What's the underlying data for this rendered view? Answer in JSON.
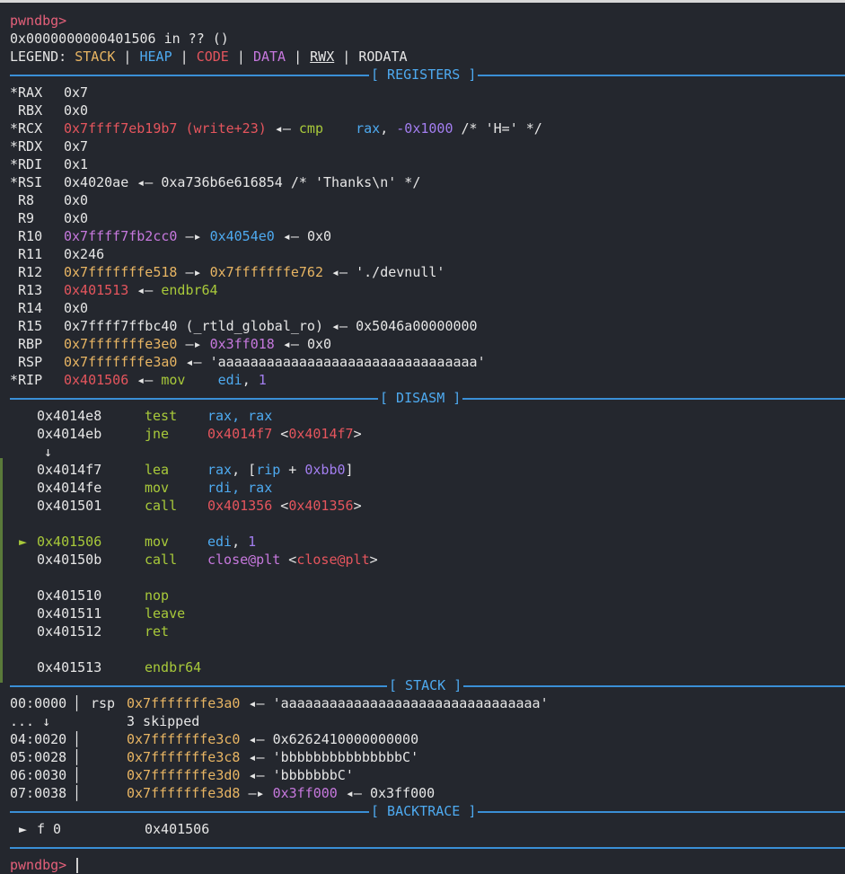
{
  "prompt": "pwndbg>",
  "location": "0x0000000000401506 in ?? ()",
  "legend": {
    "label": "LEGEND:",
    "stack": "STACK",
    "heap": "HEAP",
    "code": "CODE",
    "data": "DATA",
    "rwx": "RWX",
    "rodata": "RODATA",
    "sep": " | "
  },
  "sections": {
    "registers": "[ REGISTERS ]",
    "disasm": "[ DISASM ]",
    "stack": "[ STACK ]",
    "backtrace": "[ BACKTRACE ]"
  },
  "arrows": {
    "left": " ◂— ",
    "right": " —▸ "
  },
  "registers": {
    "rax": {
      "name": "*RAX",
      "val": "0x7"
    },
    "rbx": {
      "name": " RBX",
      "val": "0x0"
    },
    "rcx": {
      "name": "*RCX",
      "val": "0x7ffff7eb19b7 (write+23)",
      "mn": "cmp",
      "op1": "rax",
      "op2": "-0x1000",
      "cmt": " /* 'H=' */"
    },
    "rdx": {
      "name": "*RDX",
      "val": "0x7"
    },
    "rdi": {
      "name": "*RDI",
      "val": "0x1"
    },
    "rsi": {
      "name": "*RSI",
      "val": "0x4020ae",
      "deref": "0xa736b6e616854",
      "cmt": " /* 'Thanks\\n' */"
    },
    "r8": {
      "name": " R8",
      "val": "0x0"
    },
    "r9": {
      "name": " R9",
      "val": "0x0"
    },
    "r10": {
      "name": " R10",
      "val": "0x7ffff7fb2cc0",
      "p1": "0x4054e0",
      "p2": "0x0"
    },
    "r11": {
      "name": " R11",
      "val": "0x246"
    },
    "r12": {
      "name": " R12",
      "val": "0x7fffffffe518",
      "p1": "0x7fffffffe762",
      "str": "'./devnull'"
    },
    "r13": {
      "name": " R13",
      "val": "0x401513",
      "mn": "endbr64"
    },
    "r14": {
      "name": " R14",
      "val": "0x0"
    },
    "r15": {
      "name": " R15",
      "val": "0x7ffff7ffbc40 (_rtld_global_ro)",
      "deref": "0x5046a00000000"
    },
    "rbp": {
      "name": " RBP",
      "val": "0x7fffffffe3e0",
      "p1": "0x3ff018",
      "p2": "0x0"
    },
    "rsp": {
      "name": " RSP",
      "val": "0x7fffffffe3a0",
      "str": "'aaaaaaaaaaaaaaaaaaaaaaaaaaaaaaaa'"
    },
    "rip": {
      "name": "*RIP",
      "val": "0x401506",
      "mn": "mov",
      "op1": "edi",
      "op2": "1"
    }
  },
  "disasm": {
    "i1": {
      "addr": "0x4014e8",
      "mn": "test",
      "ops": "rax, rax"
    },
    "i2": {
      "addr": "0x4014eb",
      "mn": "jne",
      "target": "0x4014f7",
      "tgt2": "0x4014f7"
    },
    "jmp_arrow": "↓",
    "i3": {
      "addr": "0x4014f7",
      "mn": "lea",
      "op1": "rax",
      "op2": "rip",
      "op3": "0xbb0"
    },
    "i4": {
      "addr": "0x4014fe",
      "mn": "mov",
      "ops": "rdi, rax"
    },
    "i5": {
      "addr": "0x401501",
      "mn": "call",
      "target": "0x401356",
      "tgt2": "0x401356"
    },
    "i6": {
      "marker": "►",
      "addr": "0x401506",
      "mn": "mov",
      "op1": "edi",
      "op2": "1"
    },
    "i7": {
      "addr": "0x40150b",
      "mn": "call",
      "target": "close@plt",
      "tgt2": "close@plt"
    },
    "i8": {
      "addr": "0x401510",
      "mn": "nop"
    },
    "i9": {
      "addr": "0x401511",
      "mn": "leave"
    },
    "i10": {
      "addr": "0x401512",
      "mn": "ret"
    },
    "i11": {
      "addr": "0x401513",
      "mn": "endbr64"
    }
  },
  "stack": {
    "s0": {
      "off": "00:0000",
      "reg": "rsp",
      "addr": "0x7fffffffe3a0",
      "val": "'aaaaaaaaaaaaaaaaaaaaaaaaaaaaaaaa'"
    },
    "skip": {
      "off": "... ↓",
      "text": "3 skipped"
    },
    "s4": {
      "off": "04:0020",
      "addr": "0x7fffffffe3c0",
      "val": "0x6262410000000000"
    },
    "s5": {
      "off": "05:0028",
      "addr": "0x7fffffffe3c8",
      "val": "'bbbbbbbbbbbbbbbC'"
    },
    "s6": {
      "off": "06:0030",
      "addr": "0x7fffffffe3d0",
      "val": "'bbbbbbbC'"
    },
    "s7": {
      "off": "07:0038",
      "addr": "0x7fffffffe3d8",
      "p1": "0x3ff000",
      "p2": "0x3ff000"
    }
  },
  "backtrace": {
    "marker": "►",
    "frame": "f 0",
    "addr": "0x401506"
  }
}
